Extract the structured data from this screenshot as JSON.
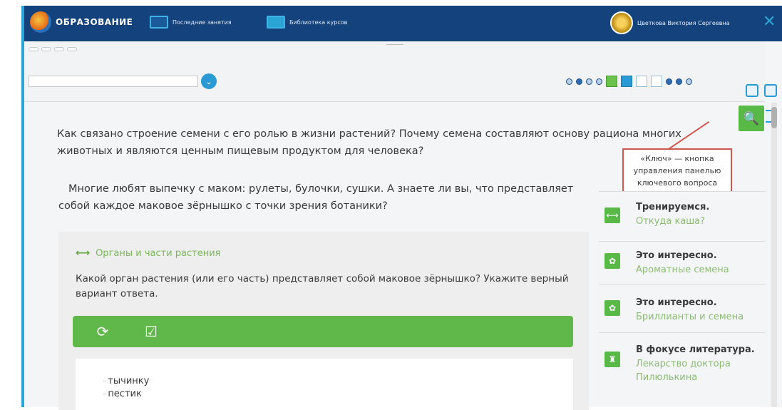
{
  "header": {
    "logo_small": "",
    "logo_title": "ОБРАЗОВАНИЕ",
    "nav_recent": "Последние занятия",
    "nav_library": "Библиотека курсов",
    "user_name": "Цветкова Виктория Сергеевна",
    "user_role": "",
    "close": "✕"
  },
  "toolbar": {
    "breadcrumbs": [
      "",
      "",
      "",
      ""
    ],
    "tab_label": "",
    "lesson_title": "",
    "lesson_button": "⌄"
  },
  "key_question": {
    "text": "Как связано строение семени с его ролью в жизни растений? Почему семена составляют основу рациона многих животных и являются ценным пищевым продуктом для человека?",
    "key_icon": "🔍",
    "callout": "«Ключ» — кнопка управления панелью ключевого вопроса"
  },
  "main": {
    "intro": "Многие любят выпечку с маком: рулеты, булочки, сушки. А знаете ли вы, что представляет собой каждое маковое зёрнышко с точки зрения ботаники?",
    "task": {
      "header": "Органы и части растения",
      "header_icon": "⟷",
      "question": "Какой орган растения (или его часть) представляет собой маковое зёрнышко? Укажите верный вариант ответа.",
      "refresh_icon": "⟳",
      "check_icon": "☑",
      "answers": [
        "тычинку",
        "пестик"
      ]
    }
  },
  "right_panel": {
    "cards": [
      {
        "title": "Тренируемся.",
        "subtitle": "Откуда каша?",
        "icon": "⟷"
      },
      {
        "title": "Это интересно.",
        "subtitle": "Ароматные семена",
        "icon": "✿"
      },
      {
        "title": "Это интересно.",
        "subtitle": "Бриллианты и семена",
        "icon": "✿"
      },
      {
        "title": "В фокусе литература.",
        "subtitle": "Лекарство доктора Пилюлькина",
        "icon": "♜"
      }
    ]
  }
}
